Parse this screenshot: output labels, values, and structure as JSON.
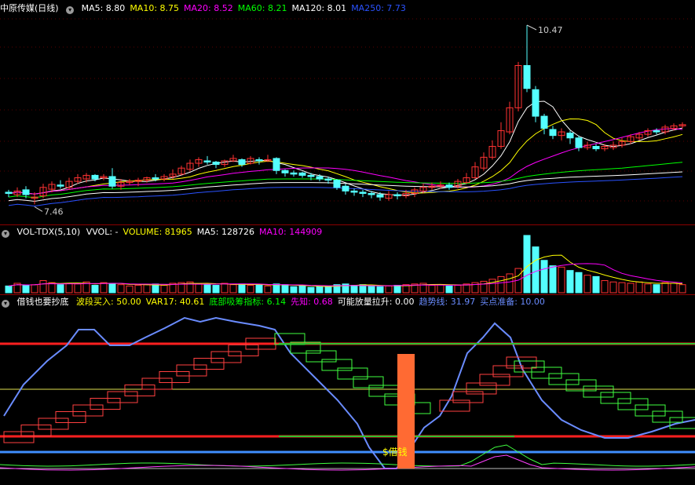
{
  "panels": {
    "price": {
      "title": "中原传媒(日线)",
      "ma": [
        {
          "label": "MA5: 8.80",
          "color": "#ffffff"
        },
        {
          "label": "MA10: 8.75",
          "color": "#ffff00"
        },
        {
          "label": "MA20: 8.52",
          "color": "#ff00ff"
        },
        {
          "label": "MA60: 8.21",
          "color": "#00ff00"
        },
        {
          "label": "MA120: 8.01",
          "color": "#ffffff"
        },
        {
          "label": "MA250: 7.73",
          "color": "#2a52ff"
        }
      ],
      "high_label": "10.47",
      "low_label": "7.46"
    },
    "volume": {
      "title": "VOL-TDX(5,10)",
      "items": [
        {
          "label": "VVOL: -",
          "color": "#ffffff"
        },
        {
          "label": "VOLUME: 81965",
          "color": "#ffff00"
        },
        {
          "label": "MA5: 128726",
          "color": "#ffffff"
        },
        {
          "label": "MA10: 144909",
          "color": "#ff00ff"
        }
      ]
    },
    "indicator": {
      "title": "借钱也要抄底",
      "items": [
        {
          "label": "波段买入: 50.00",
          "color": "#ffff00"
        },
        {
          "label": "VAR17: 40.61",
          "color": "#ffff00"
        },
        {
          "label": "底部吸筹指标: 6.14",
          "color": "#00ff00"
        },
        {
          "label": "先知: 0.68",
          "color": "#ff00ff"
        },
        {
          "label": "可能放量拉升: 0.00",
          "color": "#ffffff"
        },
        {
          "label": "趋势线: 31.97",
          "color": "#6a8cff"
        },
        {
          "label": "买点准备: 10.00",
          "color": "#6a8cff"
        }
      ],
      "signal_label": "$借钱"
    }
  },
  "colors": {
    "up": "#ff3232",
    "down": "#54ffff",
    "background": "#000000"
  },
  "chart_data": {
    "type": "candlestick",
    "candles": [
      [
        7.7,
        7.68,
        7.74,
        7.62
      ],
      [
        7.66,
        7.72,
        7.78,
        7.62
      ],
      [
        7.74,
        7.66,
        7.8,
        7.6
      ],
      [
        7.6,
        7.62,
        7.7,
        7.5
      ],
      [
        7.64,
        7.78,
        7.84,
        7.6
      ],
      [
        7.75,
        7.83,
        7.88,
        7.7
      ],
      [
        7.82,
        7.8,
        7.9,
        7.76
      ],
      [
        7.78,
        7.88,
        7.94,
        7.74
      ],
      [
        7.88,
        7.94,
        8.0,
        7.84
      ],
      [
        7.92,
        7.98,
        8.02,
        7.86
      ],
      [
        7.98,
        7.92,
        8.0,
        7.88
      ],
      [
        7.94,
        7.96,
        8.0,
        7.9
      ],
      [
        7.96,
        7.8,
        8.1,
        7.76
      ],
      [
        7.8,
        7.86,
        7.92,
        7.74
      ],
      [
        7.86,
        7.88,
        7.92,
        7.82
      ],
      [
        7.88,
        7.9,
        7.94,
        7.8
      ],
      [
        7.9,
        7.94,
        7.96,
        7.86
      ],
      [
        7.94,
        7.92,
        8.0,
        7.88
      ],
      [
        7.92,
        7.96,
        8.0,
        7.88
      ],
      [
        7.96,
        8.0,
        8.08,
        7.92
      ],
      [
        8.0,
        8.1,
        8.14,
        7.98
      ],
      [
        8.08,
        8.18,
        8.24,
        8.04
      ],
      [
        8.18,
        8.24,
        8.28,
        8.12
      ],
      [
        8.22,
        8.2,
        8.3,
        8.16
      ],
      [
        8.2,
        8.16,
        8.22,
        8.1
      ],
      [
        8.16,
        8.22,
        8.24,
        8.12
      ],
      [
        8.22,
        8.26,
        8.32,
        8.2
      ],
      [
        8.24,
        8.16,
        8.26,
        8.12
      ],
      [
        8.18,
        8.26,
        8.3,
        8.16
      ],
      [
        8.24,
        8.22,
        8.28,
        8.16
      ],
      [
        8.22,
        8.24,
        8.32,
        8.2
      ],
      [
        8.26,
        8.06,
        8.28,
        8.0
      ],
      [
        8.06,
        8.02,
        8.08,
        7.96
      ],
      [
        8.02,
        8.0,
        8.06,
        7.96
      ],
      [
        8.02,
        7.98,
        8.04,
        7.94
      ],
      [
        7.98,
        7.96,
        8.02,
        7.9
      ],
      [
        7.96,
        7.92,
        8.0,
        7.88
      ],
      [
        7.92,
        7.9,
        7.96,
        7.84
      ],
      [
        7.9,
        7.78,
        7.92,
        7.74
      ],
      [
        7.8,
        7.72,
        7.84,
        7.66
      ],
      [
        7.72,
        7.7,
        7.76,
        7.64
      ],
      [
        7.7,
        7.68,
        7.74,
        7.62
      ],
      [
        7.68,
        7.66,
        7.72,
        7.6
      ],
      [
        7.66,
        7.62,
        7.7,
        7.56
      ],
      [
        7.6,
        7.66,
        7.72,
        7.56
      ],
      [
        7.66,
        7.64,
        7.7,
        7.58
      ],
      [
        7.64,
        7.68,
        7.74,
        7.6
      ],
      [
        7.68,
        7.74,
        7.78,
        7.62
      ],
      [
        7.72,
        7.78,
        7.84,
        7.68
      ],
      [
        7.78,
        7.8,
        7.86,
        7.74
      ],
      [
        7.8,
        7.82,
        7.88,
        7.76
      ],
      [
        7.82,
        7.78,
        7.86,
        7.74
      ],
      [
        7.8,
        7.88,
        7.92,
        7.76
      ],
      [
        7.86,
        7.94,
        8.02,
        7.84
      ],
      [
        7.94,
        8.12,
        8.2,
        7.92
      ],
      [
        8.1,
        8.28,
        8.36,
        8.06
      ],
      [
        8.28,
        8.46,
        8.56,
        8.24
      ],
      [
        8.46,
        8.72,
        8.86,
        8.42
      ],
      [
        8.7,
        9.1,
        9.2,
        8.66
      ],
      [
        9.1,
        9.8,
        9.86,
        9.04
      ],
      [
        9.8,
        9.42,
        10.47,
        9.36
      ],
      [
        9.4,
        8.96,
        9.46,
        8.86
      ],
      [
        8.96,
        8.76,
        9.0,
        8.66
      ],
      [
        8.74,
        8.64,
        8.8,
        8.58
      ],
      [
        8.64,
        8.7,
        8.76,
        8.56
      ],
      [
        8.68,
        8.6,
        8.72,
        8.5
      ],
      [
        8.6,
        8.44,
        8.64,
        8.38
      ],
      [
        8.44,
        8.48,
        8.54,
        8.4
      ],
      [
        8.46,
        8.42,
        8.5,
        8.38
      ],
      [
        8.42,
        8.46,
        8.5,
        8.38
      ],
      [
        8.44,
        8.48,
        8.54,
        8.4
      ],
      [
        8.48,
        8.54,
        8.6,
        8.44
      ],
      [
        8.54,
        8.62,
        8.66,
        8.5
      ],
      [
        8.6,
        8.66,
        8.7,
        8.56
      ],
      [
        8.66,
        8.72,
        8.76,
        8.62
      ],
      [
        8.72,
        8.7,
        8.76,
        8.66
      ],
      [
        8.7,
        8.78,
        8.82,
        8.66
      ],
      [
        8.76,
        8.8,
        8.84,
        8.72
      ],
      [
        8.8,
        8.82,
        8.86,
        8.76
      ]
    ],
    "volume": [
      0.1,
      0.14,
      0.11,
      0.12,
      0.18,
      0.15,
      0.12,
      0.14,
      0.13,
      0.16,
      0.11,
      0.15,
      0.14,
      0.12,
      0.1,
      0.11,
      0.12,
      0.13,
      0.11,
      0.14,
      0.15,
      0.16,
      0.13,
      0.12,
      0.11,
      0.14,
      0.12,
      0.13,
      0.11,
      0.12,
      0.1,
      0.13,
      0.12,
      0.09,
      0.1,
      0.08,
      0.09,
      0.1,
      0.12,
      0.13,
      0.11,
      0.12,
      0.1,
      0.09,
      0.1,
      0.11,
      0.12,
      0.13,
      0.14,
      0.11,
      0.12,
      0.1,
      0.11,
      0.13,
      0.15,
      0.17,
      0.2,
      0.24,
      0.28,
      0.36,
      0.85,
      0.68,
      0.48,
      0.4,
      0.38,
      0.33,
      0.3,
      0.26,
      0.24,
      0.18,
      0.16,
      0.15,
      0.14,
      0.16,
      0.13,
      0.12,
      0.15,
      0.14,
      0.12
    ],
    "price_range": [
      7.46,
      10.47
    ]
  }
}
